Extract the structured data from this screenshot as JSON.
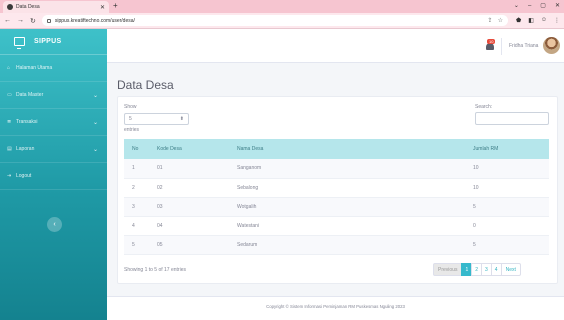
{
  "browser": {
    "tab_title": "Data Desa",
    "tab_close": "✕",
    "new_tab": "+",
    "url": "sippus.kreatiftechno.com/user/desa/",
    "win_controls": [
      "⌄",
      "–",
      "▢",
      "✕"
    ]
  },
  "sidebar": {
    "brand": "SIPPUS",
    "items": [
      {
        "label": "Halaman Utama",
        "icon": "home-icon",
        "glyph": "⌂",
        "chevron": ""
      },
      {
        "label": "Data Master",
        "icon": "folder-icon",
        "glyph": "▭",
        "chevron": "⌄"
      },
      {
        "label": "Transaksi",
        "icon": "list-icon",
        "glyph": "≣",
        "chevron": "⌄"
      },
      {
        "label": "Laporan",
        "icon": "report-icon",
        "glyph": "▤",
        "chevron": "⌄"
      },
      {
        "label": "Logout",
        "icon": "logout-icon",
        "glyph": "⇥",
        "chevron": ""
      }
    ],
    "toggle_glyph": "‹"
  },
  "topbar": {
    "notification_count": "10",
    "user_name": "Fridha Triana"
  },
  "page": {
    "title": "Data Desa",
    "show_label": "Show",
    "show_value": "5",
    "entries_label": "entries",
    "search_label": "Search:",
    "search_value": ""
  },
  "table": {
    "headers": [
      "No",
      "Kode Desa",
      "Nama Desa",
      "Jumlah RM"
    ],
    "rows": [
      [
        "1",
        "01",
        "Sanganom",
        "10"
      ],
      [
        "2",
        "02",
        "Sebalong",
        "10"
      ],
      [
        "3",
        "03",
        "Wotgalih",
        "5"
      ],
      [
        "4",
        "04",
        "Watestani",
        "0"
      ],
      [
        "5",
        "05",
        "Sedarum",
        "5"
      ]
    ]
  },
  "pagination": {
    "info": "Showing 1 to 5 of 17 entries",
    "previous": "Previous",
    "pages": [
      "1",
      "2",
      "3",
      "4"
    ],
    "next": "Next"
  },
  "footer": {
    "text": "Copyright © Sistem Informasi Peminjaman RM Puskesmas Nguling 2023"
  },
  "colors": {
    "sidebar_top": "#3ec1c9",
    "sidebar_bottom": "#14828f",
    "table_header": "#b5e6eb",
    "accent": "#36b9cc"
  }
}
